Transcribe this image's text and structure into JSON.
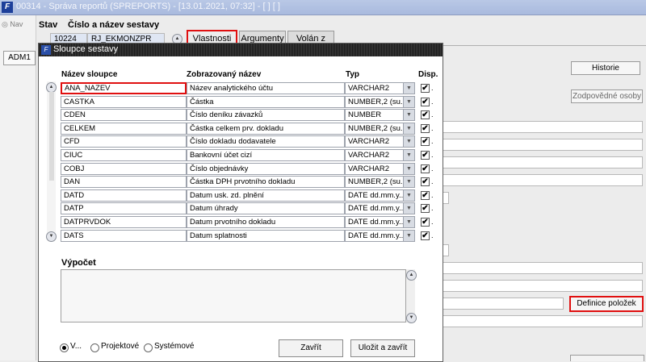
{
  "window": {
    "title": "00314 - Správa reportů (SPREPORTS) - [13.01.2021, 07:32] - [ ] [ ]"
  },
  "left": {
    "nav_label": "Nav",
    "adm_label": "ADM1"
  },
  "form": {
    "stav_label": "Stav",
    "cislo_label": "Číslo a název sestavy",
    "report_number": "10224",
    "report_name": "RJ_EKMONZPR",
    "tabs": [
      "Vlastnosti",
      "Argumenty",
      "Volán z"
    ],
    "historie_button": "Historie",
    "zodpovedne_button": "Zodpovědné osoby",
    "definice_button": "Definice položek"
  },
  "modal": {
    "title": "Sloupce sestavy",
    "headers": {
      "name": "Název sloupce",
      "display": "Zobrazovaný název",
      "type": "Typ",
      "disp": "Disp."
    },
    "rows": [
      {
        "name": "ANA_NAZEV",
        "display": "Název analytického účtu",
        "type": "VARCHAR2",
        "checked": true
      },
      {
        "name": "CASTKA",
        "display": "Částka",
        "type": "NUMBER,2 (su...",
        "checked": true
      },
      {
        "name": "CDEN",
        "display": "Číslo deníku závazků",
        "type": "NUMBER",
        "checked": true
      },
      {
        "name": "CELKEM",
        "display": "Částka celkem prv. dokladu",
        "type": "NUMBER,2 (su...",
        "checked": true
      },
      {
        "name": "CFD",
        "display": "Číslo dokladu dodavatele",
        "type": "VARCHAR2",
        "checked": true
      },
      {
        "name": "CIUC",
        "display": "Bankovní účet cizí",
        "type": "VARCHAR2",
        "checked": true
      },
      {
        "name": "COBJ",
        "display": "Číslo objednávky",
        "type": "VARCHAR2",
        "checked": true
      },
      {
        "name": "DAN",
        "display": "Částka DPH prvotního dokladu",
        "type": "NUMBER,2 (su...",
        "checked": true
      },
      {
        "name": "DATD",
        "display": "Datum usk. zd. plnění",
        "type": "DATE dd.mm.y...",
        "checked": true
      },
      {
        "name": "DATP",
        "display": "Datum úhrady",
        "type": "DATE dd.mm.y...",
        "checked": true
      },
      {
        "name": "DATPRVDOK",
        "display": "Datum prvotního dokladu",
        "type": "DATE dd.mm.y...",
        "checked": true
      },
      {
        "name": "DATS",
        "display": "Datum splatnosti",
        "type": "DATE dd.mm.y...",
        "checked": true
      }
    ],
    "vypocet_label": "Výpočet",
    "vypocet_value": "",
    "radios": [
      "V...",
      "Projektové",
      "Systémové"
    ],
    "close_button": "Zavřít",
    "save_close_button": "Uložit a zavřít",
    "accent_color": "#e01010"
  }
}
